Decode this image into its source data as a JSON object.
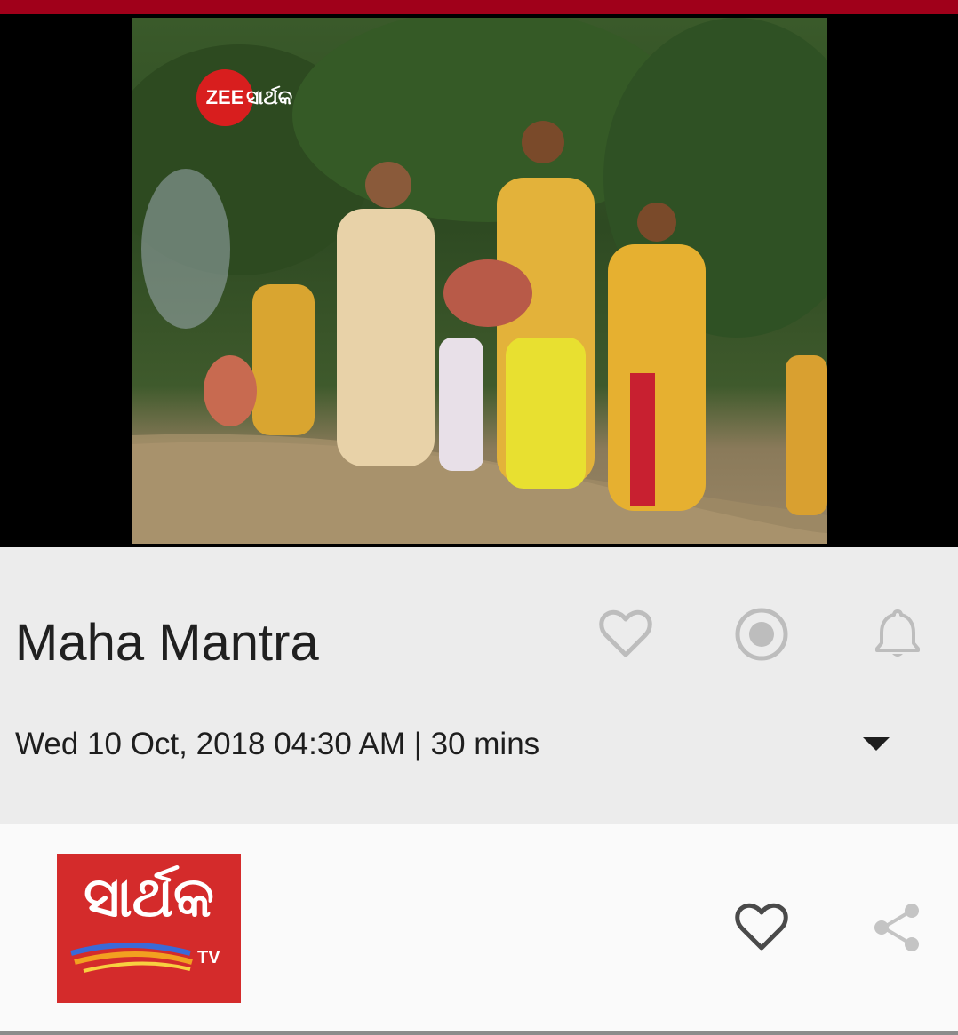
{
  "video": {
    "channel_bug": {
      "circle_text": "ZEE",
      "script_text": "ସାର୍ଥକ"
    }
  },
  "program": {
    "title": "Maha Mantra",
    "schedule": "Wed 10 Oct, 2018 04:30 AM | 30 mins"
  },
  "actions": {
    "favorite_icon": "heart-outline-icon",
    "record_icon": "record-icon",
    "reminder_icon": "bell-icon",
    "expand_icon": "caret-down-icon"
  },
  "channel": {
    "logo_text": "ସାର୍ଥକ",
    "logo_suffix": "TV",
    "favorite_icon": "heart-outline-icon",
    "share_icon": "share-icon"
  },
  "colors": {
    "status_bar": "#a0001a",
    "info_background": "#ececec",
    "icon_gray": "#bdbdbd",
    "logo_red": "#d42b2b"
  }
}
